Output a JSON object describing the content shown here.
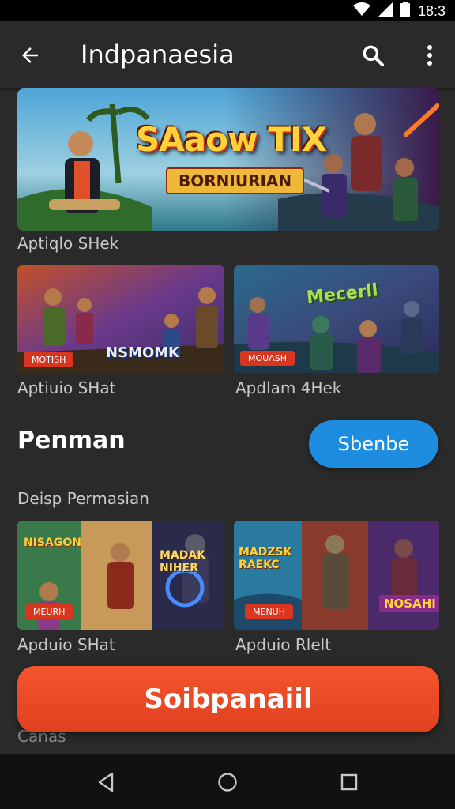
{
  "status": {
    "time": "18:3"
  },
  "appbar": {
    "title": "Indpanaesia"
  },
  "hero": {
    "logo_line1": "SAaow TIX",
    "logo_line2": "BORNIURIAN",
    "caption": "Aptiqlo SHek"
  },
  "row1": [
    {
      "logo": "NSMOMK",
      "badge": "MOTISH",
      "caption": "Aptiuio SHat"
    },
    {
      "logo": "Mecerll",
      "badge": "MOUASH",
      "caption": "Apdlam 4Hek"
    }
  ],
  "section": {
    "title": "Penman",
    "button_label": "Sbenbe",
    "subtitle": "Deisp Permasian"
  },
  "row2": [
    {
      "logo_a": "NISAGON",
      "logo_b": "MADAK NIHER",
      "badge": "MEURH",
      "caption": "Apduio SHat"
    },
    {
      "logo_a": "MADZSK RAEKC",
      "logo_b": "NOSAHI",
      "badge": "MENUH",
      "caption": "Apduio Rlelt"
    }
  ],
  "cta": {
    "label": "Soibpanaiil"
  },
  "footer_label": "Canas",
  "colors": {
    "accent_blue": "#1e8de0",
    "cta_red": "#f04a26",
    "background": "#2a2a2a"
  }
}
